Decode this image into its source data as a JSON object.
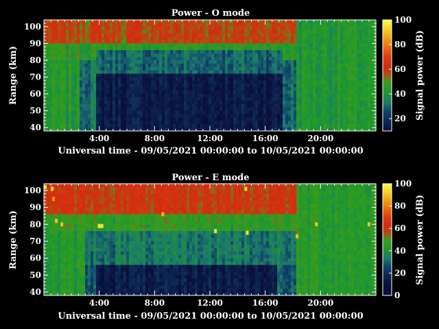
{
  "palette": {
    "stops": [
      {
        "v": 10,
        "c": "#0a0f3a"
      },
      {
        "v": 25,
        "c": "#0f3f6a"
      },
      {
        "v": 33,
        "c": "#1c7a6a"
      },
      {
        "v": 42,
        "c": "#1e9a2a"
      },
      {
        "v": 50,
        "c": "#3f9a1e"
      },
      {
        "v": 56,
        "c": "#b84a12"
      },
      {
        "v": 62,
        "c": "#d42a10"
      },
      {
        "v": 70,
        "c": "#e03a10"
      },
      {
        "v": 85,
        "c": "#f0a010"
      },
      {
        "v": 100,
        "c": "#ffff40"
      }
    ]
  },
  "chart_data": [
    {
      "type": "heatmap",
      "title": "Power - O mode",
      "xlabel": "Universal time - 09/05/2021 00:00:00 to 10/05/2021 00:00:00",
      "ylabel": "Range (km)",
      "colorbar_label": "Signal power (dB)",
      "x_ticks": [
        "4:00",
        "8:00",
        "12:00",
        "16:00",
        "20:00"
      ],
      "x_tick_hours": [
        4,
        8,
        12,
        16,
        20
      ],
      "xlim_hours": [
        0,
        24
      ],
      "y_ticks": [
        40,
        50,
        60,
        70,
        80,
        90,
        100
      ],
      "ylim": [
        38,
        104
      ],
      "colorbar_ticks": [
        20,
        40,
        60,
        80,
        100
      ],
      "colorbar_range": [
        10,
        100
      ],
      "layers": [
        {
          "range_min": 90,
          "range_max": 104,
          "hour_min": 0,
          "hour_max": 24,
          "db": 58
        },
        {
          "range_min": 81,
          "range_max": 90,
          "hour_min": 0,
          "hour_max": 24,
          "db": 45
        },
        {
          "range_min": 38,
          "range_max": 81,
          "hour_min": 0,
          "hour_max": 24,
          "db": 42
        },
        {
          "range_min": 38,
          "range_max": 81,
          "hour_min": 2.6,
          "hour_max": 3.8,
          "db": 33
        },
        {
          "range_min": 72,
          "range_max": 86,
          "hour_min": 3.8,
          "hour_max": 17.2,
          "db": 30
        },
        {
          "range_min": 38,
          "range_max": 72,
          "hour_min": 3.8,
          "hour_max": 17.2,
          "db": 14
        },
        {
          "range_min": 38,
          "range_max": 80,
          "hour_min": 17.2,
          "hour_max": 18.3,
          "db": 30
        },
        {
          "range_min": 38,
          "range_max": 104,
          "hour_min": 18.3,
          "hour_max": 24,
          "db": 42
        }
      ]
    },
    {
      "type": "heatmap",
      "title": "Power - E mode",
      "xlabel": "Universal time - 09/05/2021 00:00:00 to 10/05/2021 00:00:00",
      "ylabel": "Range (km)",
      "colorbar_label": "Signal power (dB)",
      "x_ticks": [
        "4:00",
        "8:00",
        "12:00",
        "16:00",
        "20:00"
      ],
      "x_tick_hours": [
        4,
        8,
        12,
        16,
        20
      ],
      "xlim_hours": [
        0,
        24
      ],
      "y_ticks": [
        40,
        50,
        60,
        70,
        80,
        90,
        100
      ],
      "ylim": [
        38,
        104
      ],
      "colorbar_ticks": [
        0,
        20,
        40,
        60,
        80,
        100
      ],
      "colorbar_range": [
        0,
        100
      ],
      "layers": [
        {
          "range_min": 86,
          "range_max": 104,
          "hour_min": 0,
          "hour_max": 24,
          "db": 60
        },
        {
          "range_min": 77,
          "range_max": 86,
          "hour_min": 0,
          "hour_max": 24,
          "db": 46
        },
        {
          "range_min": 38,
          "range_max": 77,
          "hour_min": 0,
          "hour_max": 24,
          "db": 42
        },
        {
          "range_min": 56,
          "range_max": 77,
          "hour_min": 3.0,
          "hour_max": 18.2,
          "db": 33
        },
        {
          "range_min": 38,
          "range_max": 56,
          "hour_min": 3.0,
          "hour_max": 3.8,
          "db": 28
        },
        {
          "range_min": 38,
          "range_max": 56,
          "hour_min": 3.8,
          "hour_max": 16.8,
          "db": 14
        },
        {
          "range_min": 38,
          "range_max": 56,
          "hour_min": 16.8,
          "hour_max": 18.2,
          "db": 28
        },
        {
          "range_min": 38,
          "range_max": 104,
          "hour_min": 18.2,
          "hour_max": 24,
          "db": 44
        }
      ],
      "spots": [
        {
          "hour": 0.1,
          "range": 102,
          "db": 95
        },
        {
          "hour": 0.6,
          "range": 101,
          "db": 95
        },
        {
          "hour": 0.7,
          "range": 95,
          "db": 85
        },
        {
          "hour": 0.9,
          "range": 82,
          "db": 90
        },
        {
          "hour": 1.3,
          "range": 80,
          "db": 90
        },
        {
          "hour": 4.0,
          "range": 79,
          "db": 95
        },
        {
          "hour": 4.2,
          "range": 79,
          "db": 95
        },
        {
          "hour": 8.6,
          "range": 86,
          "db": 88
        },
        {
          "hour": 12.4,
          "range": 76,
          "db": 95
        },
        {
          "hour": 14.7,
          "range": 75,
          "db": 95
        },
        {
          "hour": 18.3,
          "range": 73,
          "db": 90
        },
        {
          "hour": 19.7,
          "range": 80,
          "db": 90
        },
        {
          "hour": 14.6,
          "range": 101,
          "db": 95
        },
        {
          "hour": 23.5,
          "range": 80,
          "db": 90
        }
      ]
    }
  ]
}
